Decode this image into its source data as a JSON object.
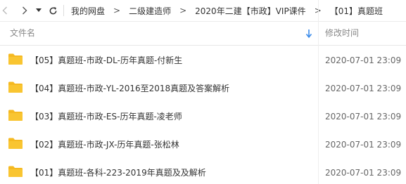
{
  "breadcrumb": {
    "items": [
      "我的网盘",
      "二级建造师",
      "2020年二建【市政】VIP课件",
      "【01】真题班"
    ],
    "separator": ">"
  },
  "header": {
    "name_label": "文件名",
    "time_label": "修改时间"
  },
  "files": [
    {
      "name": "【05】真题班-市政-DL-历年真题-付新生",
      "modified": "2020-07-01 23:09"
    },
    {
      "name": "【04】真题班-市政-YL-2016至2018真题及答案解析",
      "modified": "2020-07-01 23:09"
    },
    {
      "name": "【03】真题班-市政-ES-历年真题-凌老师",
      "modified": "2020-07-01 23:09"
    },
    {
      "name": "【02】真题班-市政-JX-历年真题-张松林",
      "modified": "2020-07-01 23:09"
    },
    {
      "name": "【01】真题班-各科-223-2019年真题及及解析",
      "modified": "2020-07-01 23:09"
    }
  ],
  "colors": {
    "folder": "#F5B921",
    "sort_arrow": "#3B8BEA"
  },
  "icons": {
    "back": "chevron-left-icon",
    "forward": "chevron-right-icon",
    "history": "caret-down-icon",
    "refresh": "refresh-icon",
    "sort": "sort-down-icon",
    "folder": "folder-icon"
  }
}
